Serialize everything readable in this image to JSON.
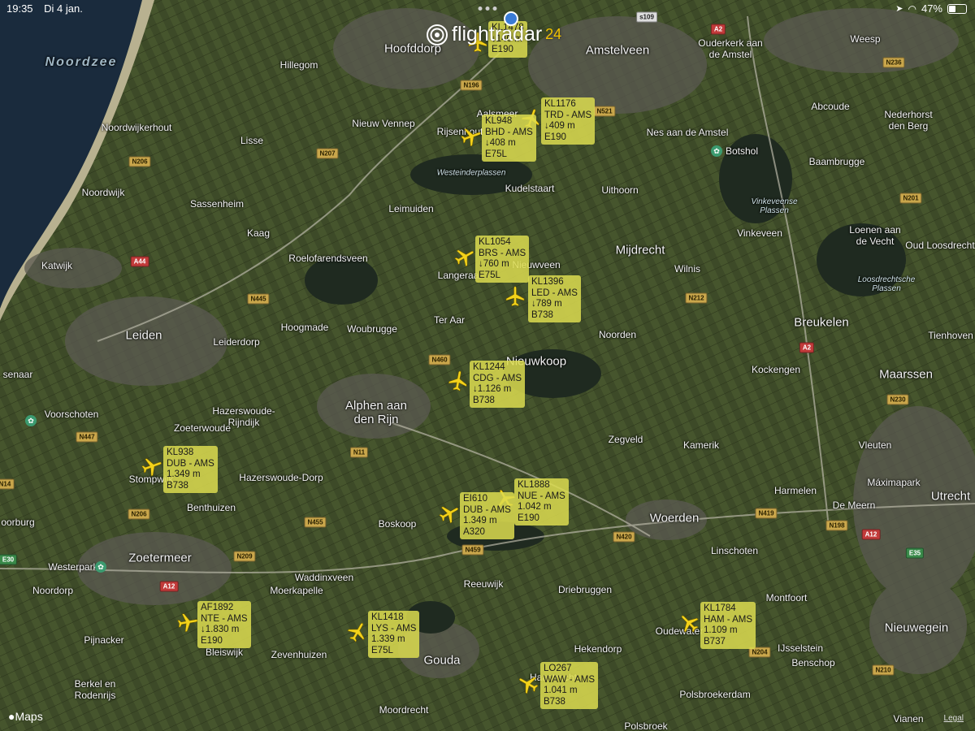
{
  "status_bar": {
    "time": "19:35",
    "date": "Di 4 jan.",
    "battery": "47%",
    "battery_level": 0.47
  },
  "app": {
    "logo_text": "flightradar",
    "logo_number": "24"
  },
  "map": {
    "attribution": "Maps",
    "legal": "Legal",
    "places": [
      {
        "name": "Noordzee",
        "kind": "sea"
      },
      {
        "name": "Hoofddorp",
        "kind": "city"
      },
      {
        "name": "Amstelveen",
        "kind": "city"
      },
      {
        "name": "Weesp",
        "kind": "town"
      },
      {
        "name": "Ouderkerk aan\nde Amstel",
        "kind": "town"
      },
      {
        "name": "Hillegom",
        "kind": "town"
      },
      {
        "name": "Noordwijkerhout",
        "kind": "town"
      },
      {
        "name": "Lisse",
        "kind": "town"
      },
      {
        "name": "Nieuw Vennep",
        "kind": "town"
      },
      {
        "name": "Aalsmeer",
        "kind": "town"
      },
      {
        "name": "Rijsenhout",
        "kind": "town"
      },
      {
        "name": "Abcoude",
        "kind": "town"
      },
      {
        "name": "Nederhorst\nden Berg",
        "kind": "town"
      },
      {
        "name": "Nes aan de Amstel",
        "kind": "town"
      },
      {
        "name": "Botshol",
        "kind": "town"
      },
      {
        "name": "Baambrugge",
        "kind": "town"
      },
      {
        "name": "Westeinderplassen",
        "kind": "water"
      },
      {
        "name": "Kudelstaart",
        "kind": "town"
      },
      {
        "name": "Uithoorn",
        "kind": "town"
      },
      {
        "name": "Noordwijk",
        "kind": "town"
      },
      {
        "name": "Sassenheim",
        "kind": "town"
      },
      {
        "name": "Leimuiden",
        "kind": "town"
      },
      {
        "name": "Vinkeveense\nPlassen",
        "kind": "water"
      },
      {
        "name": "Loenen aan\nde Vecht",
        "kind": "town"
      },
      {
        "name": "Oud Loosdrecht",
        "kind": "town"
      },
      {
        "name": "Kaag",
        "kind": "town"
      },
      {
        "name": "Vinkeveen",
        "kind": "town"
      },
      {
        "name": "Katwijk",
        "kind": "town"
      },
      {
        "name": "Roelofarendsveen",
        "kind": "town"
      },
      {
        "name": "Langeraar",
        "kind": "town"
      },
      {
        "name": "Nieuwveen",
        "kind": "town"
      },
      {
        "name": "Mijdrecht",
        "kind": "city"
      },
      {
        "name": "Wilnis",
        "kind": "town"
      },
      {
        "name": "Loosdrechtsche\nPlassen",
        "kind": "water"
      },
      {
        "name": "Leiden",
        "kind": "city"
      },
      {
        "name": "Hoogmade",
        "kind": "town"
      },
      {
        "name": "Woubrugge",
        "kind": "town"
      },
      {
        "name": "Ter Aar",
        "kind": "town"
      },
      {
        "name": "Noorden",
        "kind": "town"
      },
      {
        "name": "Breukelen",
        "kind": "city"
      },
      {
        "name": "Tienhoven",
        "kind": "town"
      },
      {
        "name": "Leiderdorp",
        "kind": "town"
      },
      {
        "name": "Nieuwkoop",
        "kind": "city"
      },
      {
        "name": "Kockengen",
        "kind": "town"
      },
      {
        "name": "Maarssen",
        "kind": "city"
      },
      {
        "name": "senaar",
        "kind": "town"
      },
      {
        "name": "Voorschoten",
        "kind": "town"
      },
      {
        "name": "Hazerswoude-\nRijndijk",
        "kind": "town"
      },
      {
        "name": "Alphen aan\nden Rijn",
        "kind": "city"
      },
      {
        "name": "Zoeterwoude",
        "kind": "town"
      },
      {
        "name": "Zegveld",
        "kind": "town"
      },
      {
        "name": "Kamerik",
        "kind": "town"
      },
      {
        "name": "Vleuten",
        "kind": "town"
      },
      {
        "name": "Hazerswoude-Dorp",
        "kind": "town"
      },
      {
        "name": "Stompwijk",
        "kind": "town"
      },
      {
        "name": "Harmelen",
        "kind": "town"
      },
      {
        "name": "De Meern",
        "kind": "town"
      },
      {
        "name": "Máximapark",
        "kind": "town"
      },
      {
        "name": "Utrecht",
        "kind": "city"
      },
      {
        "name": "Woerden",
        "kind": "city"
      },
      {
        "name": "Benthuizen",
        "kind": "town"
      },
      {
        "name": "Boskoop",
        "kind": "town"
      },
      {
        "name": "oorburg",
        "kind": "town"
      },
      {
        "name": "Linschoten",
        "kind": "town"
      },
      {
        "name": "Zoetermeer",
        "kind": "city"
      },
      {
        "name": "Westerpark",
        "kind": "town"
      },
      {
        "name": "Waddinxveen",
        "kind": "town"
      },
      {
        "name": "Montfoort",
        "kind": "town"
      },
      {
        "name": "Noordorp",
        "kind": "town"
      },
      {
        "name": "Moerkapelle",
        "kind": "town"
      },
      {
        "name": "Reeuwijk",
        "kind": "town"
      },
      {
        "name": "Driebruggen",
        "kind": "town"
      },
      {
        "name": "Nieuwegein",
        "kind": "city"
      },
      {
        "name": "Pijnacker",
        "kind": "town"
      },
      {
        "name": "Bleiswijk",
        "kind": "town"
      },
      {
        "name": "Zevenhuizen",
        "kind": "town"
      },
      {
        "name": "Gouda",
        "kind": "city"
      },
      {
        "name": "Hekendorp",
        "kind": "town"
      },
      {
        "name": "Oudewater",
        "kind": "town"
      },
      {
        "name": "IJsselstein",
        "kind": "town"
      },
      {
        "name": "Benschop",
        "kind": "town"
      },
      {
        "name": "Berkel en\nRodenrijs",
        "kind": "town"
      },
      {
        "name": "Moordrecht",
        "kind": "town"
      },
      {
        "name": "Haastrecht",
        "kind": "town"
      },
      {
        "name": "Polsbroekerdam",
        "kind": "town"
      },
      {
        "name": "Polsbroek",
        "kind": "town"
      },
      {
        "name": "Vianen",
        "kind": "town"
      }
    ],
    "roads": [
      {
        "label": "s109",
        "kind": "s"
      },
      {
        "label": "A2",
        "kind": "a"
      },
      {
        "label": "N236",
        "kind": "n"
      },
      {
        "label": "N196",
        "kind": "n"
      },
      {
        "label": "N521",
        "kind": "n"
      },
      {
        "label": "N207",
        "kind": "n"
      },
      {
        "label": "N206",
        "kind": "n"
      },
      {
        "label": "N201",
        "kind": "n"
      },
      {
        "label": "A44",
        "kind": "a"
      },
      {
        "label": "N445",
        "kind": "n"
      },
      {
        "label": "N212",
        "kind": "n"
      },
      {
        "label": "A2",
        "kind": "a"
      },
      {
        "label": "N460",
        "kind": "n"
      },
      {
        "label": "N230",
        "kind": "n"
      },
      {
        "label": "N447",
        "kind": "n"
      },
      {
        "label": "N11",
        "kind": "n"
      },
      {
        "label": "N14",
        "kind": "n"
      },
      {
        "label": "N206",
        "kind": "n"
      },
      {
        "label": "N455",
        "kind": "n"
      },
      {
        "label": "N419",
        "kind": "n"
      },
      {
        "label": "N198",
        "kind": "n"
      },
      {
        "label": "A12",
        "kind": "a"
      },
      {
        "label": "N420",
        "kind": "n"
      },
      {
        "label": "E30",
        "kind": "e"
      },
      {
        "label": "N209",
        "kind": "n"
      },
      {
        "label": "N459",
        "kind": "n"
      },
      {
        "label": "E35",
        "kind": "e"
      },
      {
        "label": "A12",
        "kind": "a"
      },
      {
        "label": "N204",
        "kind": "n"
      },
      {
        "label": "N210",
        "kind": "n"
      }
    ]
  },
  "flights": [
    {
      "callsign": "KL1478",
      "route": "",
      "altitude": "↓140 m",
      "aircraft": "E190",
      "heading": 0
    },
    {
      "callsign": "KL1176",
      "route": "TRD - AMS",
      "altitude": "↓409 m",
      "aircraft": "E190",
      "heading": 20
    },
    {
      "callsign": "KL948",
      "route": "BHD - AMS",
      "altitude": "↓408 m",
      "aircraft": "E75L",
      "heading": 70
    },
    {
      "callsign": "KL1054",
      "route": "BRS - AMS",
      "altitude": "↓760 m",
      "aircraft": "E75L",
      "heading": 60
    },
    {
      "callsign": "KL1396",
      "route": "LED - AMS",
      "altitude": "↓789 m",
      "aircraft": "B738",
      "heading": 0
    },
    {
      "callsign": "KL1244",
      "route": "CDG - AMS",
      "altitude": "↓1.126 m",
      "aircraft": "B738",
      "heading": 10
    },
    {
      "callsign": "KL938",
      "route": "DUB - AMS",
      "altitude": "1.349 m",
      "aircraft": "B738",
      "heading": 70
    },
    {
      "callsign": "KL1888",
      "route": "NUE - AMS",
      "altitude": "1.042 m",
      "aircraft": "E190",
      "heading": 330
    },
    {
      "callsign": "EI610",
      "route": "DUB - AMS",
      "altitude": "1.349 m",
      "aircraft": "A320",
      "heading": 60
    },
    {
      "callsign": "AF1892",
      "route": "NTE - AMS",
      "altitude": "↓1.830 m",
      "aircraft": "E190",
      "heading": 80
    },
    {
      "callsign": "KL1418",
      "route": "LYS - AMS",
      "altitude": "1.339 m",
      "aircraft": "E75L",
      "heading": 30
    },
    {
      "callsign": "KL1784",
      "route": "HAM - AMS",
      "altitude": "1.109 m",
      "aircraft": "B737",
      "heading": 315
    },
    {
      "callsign": "LO267",
      "route": "WAW - AMS",
      "altitude": "1.041 m",
      "aircraft": "B738",
      "heading": 300
    }
  ],
  "colors": {
    "label_bg": "#dcdc50",
    "plane": "#f3d21a",
    "brand_accent": "#f3c300"
  }
}
